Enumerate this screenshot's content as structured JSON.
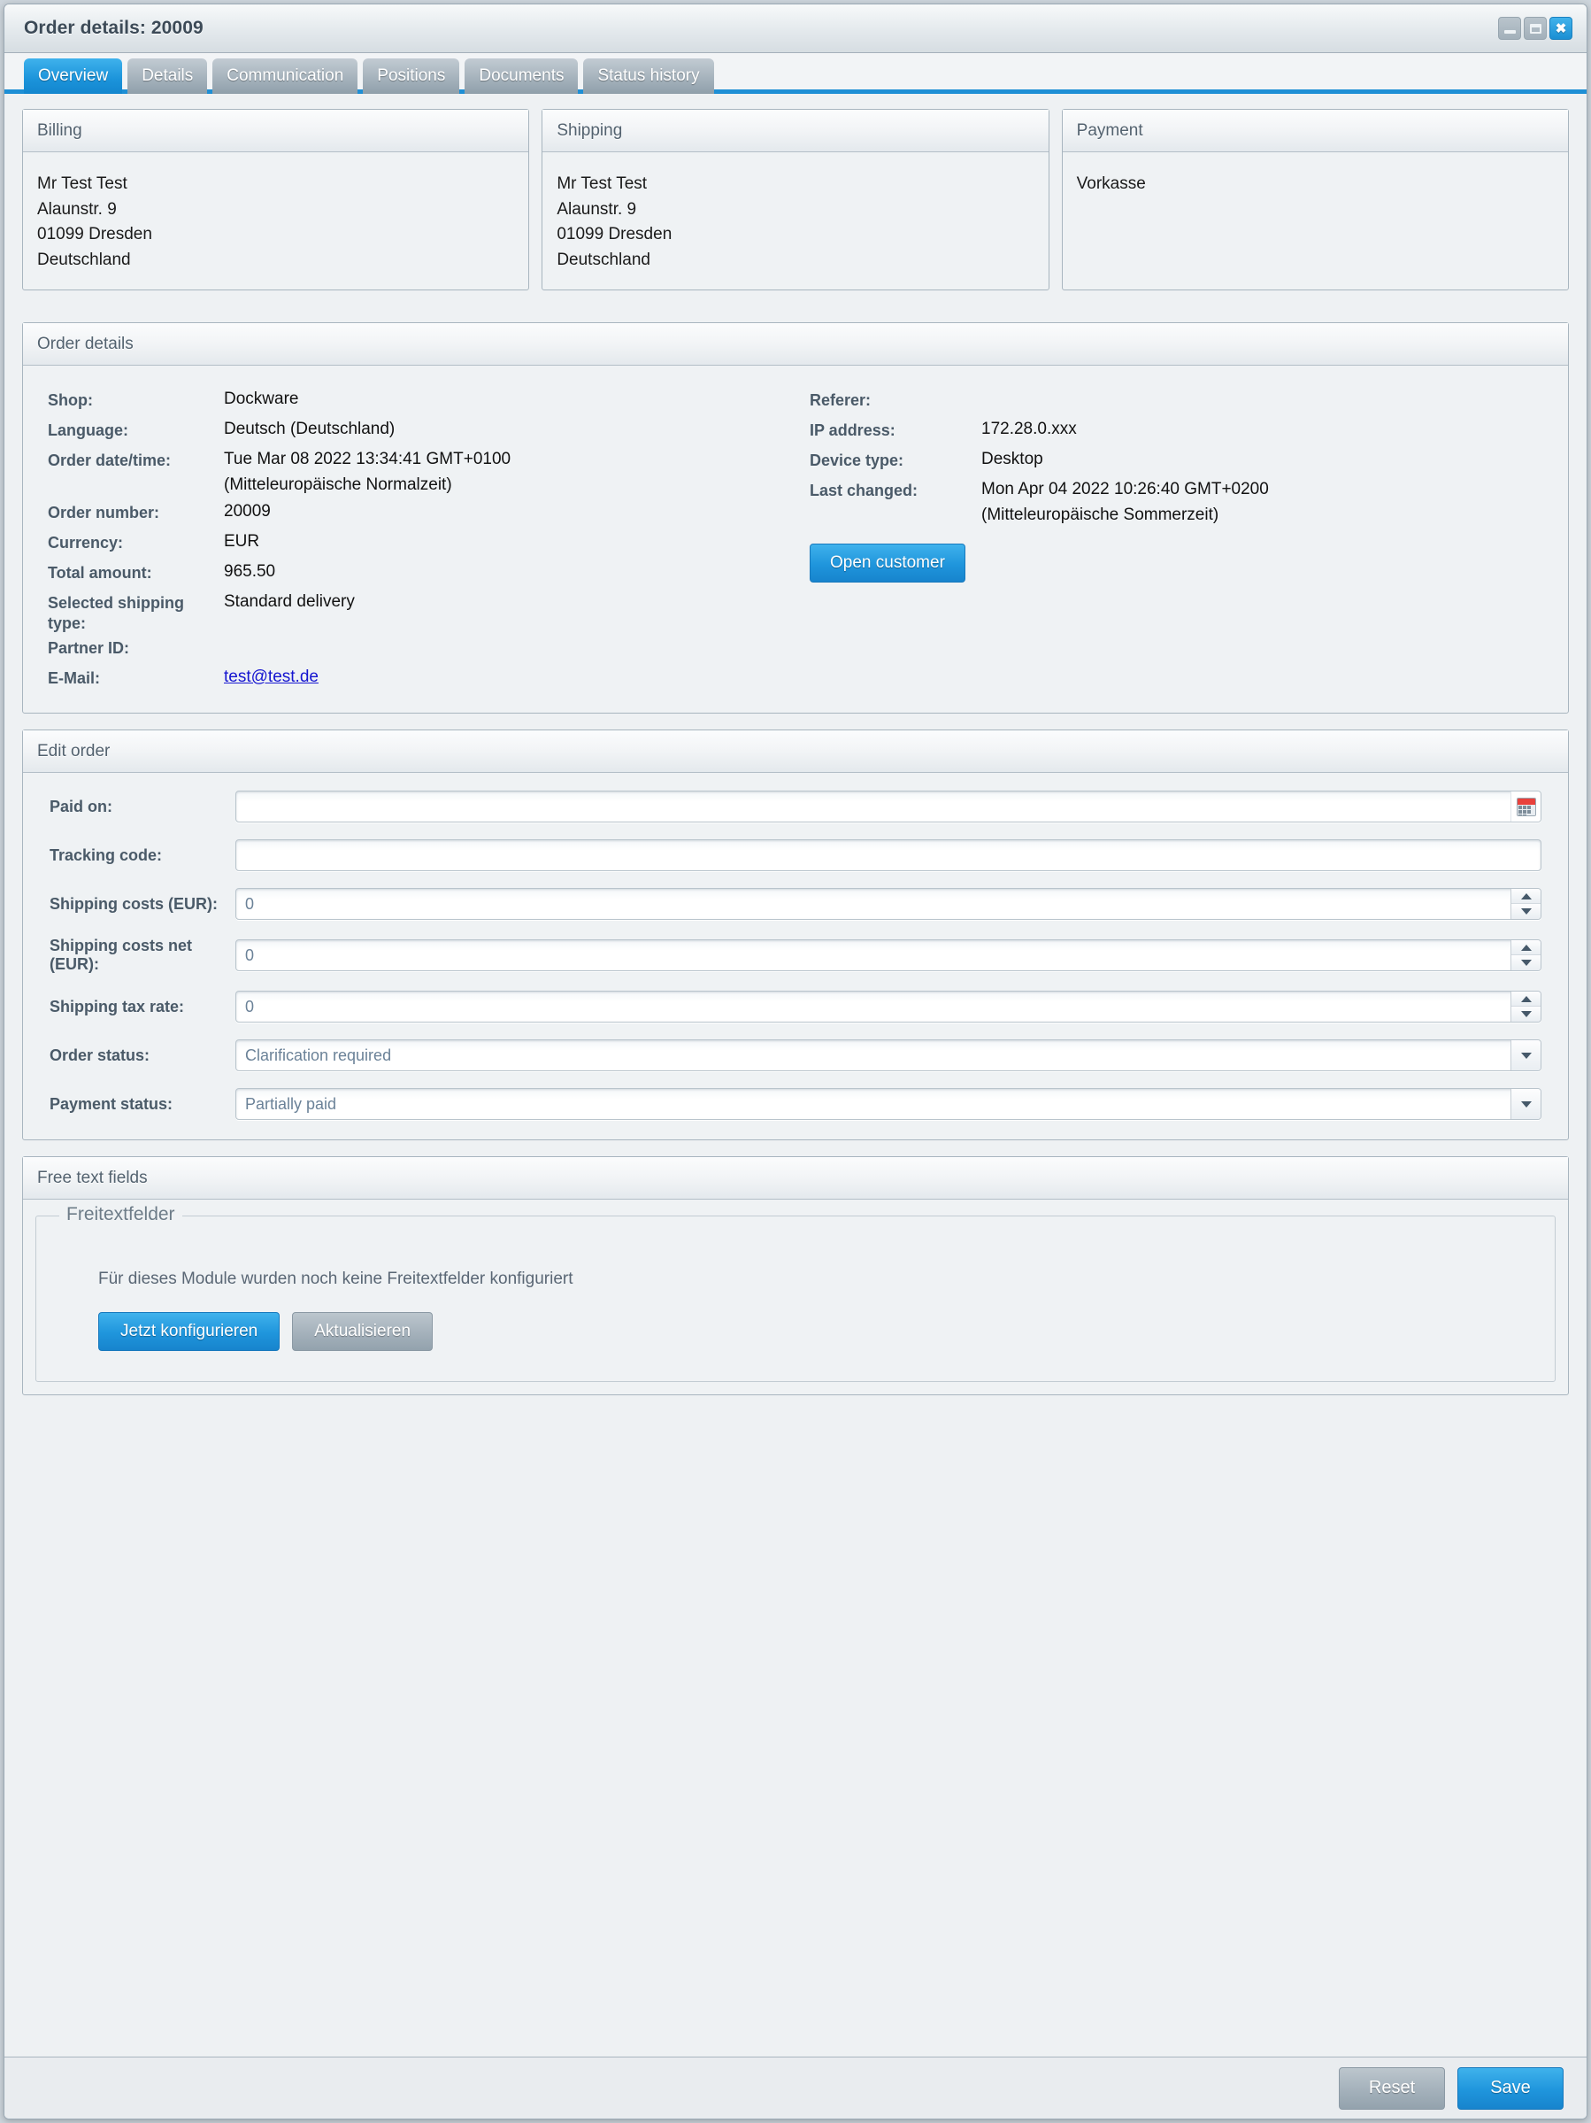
{
  "window": {
    "title": "Order details: 20009",
    "controls": [
      {
        "name": "minimize-button",
        "glyph": "minimize"
      },
      {
        "name": "maximize-button",
        "glyph": "maximize"
      },
      {
        "name": "close-button",
        "glyph": "✖"
      }
    ]
  },
  "tabs": [
    {
      "label": "Overview",
      "active": true
    },
    {
      "label": "Details",
      "active": false
    },
    {
      "label": "Communication",
      "active": false
    },
    {
      "label": "Positions",
      "active": false
    },
    {
      "label": "Documents",
      "active": false
    },
    {
      "label": "Status history",
      "active": false
    }
  ],
  "billing": {
    "title": "Billing",
    "lines": [
      "Mr Test Test",
      "Alaunstr. 9",
      "01099 Dresden",
      "Deutschland"
    ]
  },
  "shipping": {
    "title": "Shipping",
    "lines": [
      "Mr Test Test",
      "Alaunstr. 9",
      "01099 Dresden",
      "Deutschland"
    ]
  },
  "payment": {
    "title": "Payment",
    "lines": [
      "Vorkasse"
    ]
  },
  "order_details": {
    "title": "Order details",
    "left": [
      {
        "label": "Shop:",
        "value": "Dockware"
      },
      {
        "label": "Language:",
        "value": "Deutsch (Deutschland)"
      },
      {
        "label": "Order date/time:",
        "value": "Tue Mar 08 2022 13:34:41 GMT+0100\n(Mitteleuropäische Normalzeit)"
      },
      {
        "label": "Order number:",
        "value": "20009"
      },
      {
        "label": "Currency:",
        "value": "EUR"
      },
      {
        "label": "Total amount:",
        "value": "965.50"
      },
      {
        "label": "Selected shipping type:",
        "value": "Standard delivery"
      },
      {
        "label": "Partner ID:",
        "value": ""
      },
      {
        "label": "E-Mail:",
        "value": "test@test.de",
        "link": true
      }
    ],
    "right": [
      {
        "label": "Referer:",
        "value": ""
      },
      {
        "label": "IP address:",
        "value": "172.28.0.xxx"
      },
      {
        "label": "Device type:",
        "value": "Desktop"
      },
      {
        "label": "Last changed:",
        "value": "Mon Apr 04 2022 10:26:40 GMT+0200\n(Mitteleuropäische Sommerzeit)"
      }
    ],
    "open_customer_label": "Open customer"
  },
  "edit_order": {
    "title": "Edit order",
    "fields": [
      {
        "label": "Paid on:",
        "value": "",
        "placeholder": "",
        "control": "date"
      },
      {
        "label": "Tracking code:",
        "value": "",
        "placeholder": "",
        "control": "text"
      },
      {
        "label": "Shipping costs (EUR):",
        "value": "",
        "placeholder": "0",
        "control": "spinner"
      },
      {
        "label": "Shipping costs net (EUR):",
        "value": "",
        "placeholder": "0",
        "control": "spinner"
      },
      {
        "label": "Shipping tax rate:",
        "value": "",
        "placeholder": "0",
        "control": "spinner"
      },
      {
        "label": "Order status:",
        "value": "",
        "placeholder": "Clarification required",
        "control": "select"
      },
      {
        "label": "Payment status:",
        "value": "",
        "placeholder": "Partially paid",
        "control": "select"
      }
    ]
  },
  "free_text_fields": {
    "title": "Free text fields",
    "legend": "Freitextfelder",
    "message": "Für dieses Module wurden noch keine Freitextfelder konfiguriert",
    "configure_label": "Jetzt konfigurieren",
    "refresh_label": "Aktualisieren"
  },
  "footer": {
    "reset_label": "Reset",
    "save_label": "Save"
  },
  "colors": {
    "accent": "#1e8fd5",
    "tab_inactive": "#a6b3bd",
    "panel_bg": "#eff2f4",
    "label": "#4a5a68",
    "link": "#1515d0",
    "calendar_red": "#e8413c"
  }
}
